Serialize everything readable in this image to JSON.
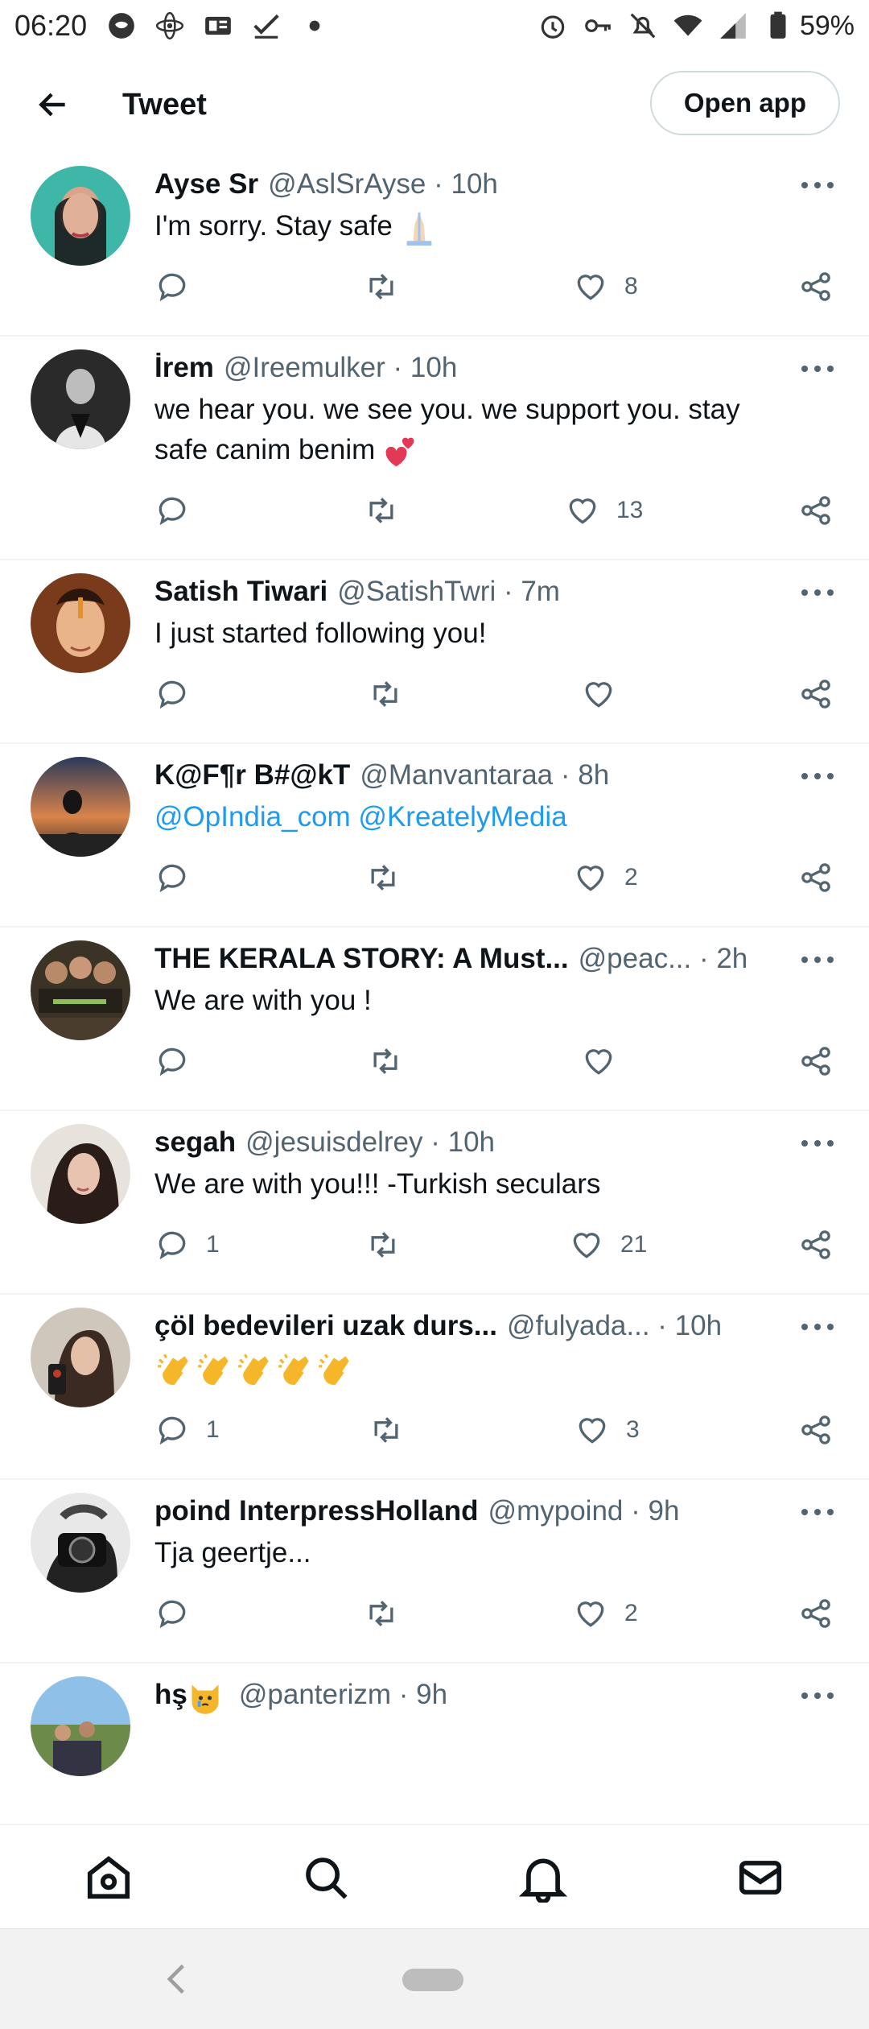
{
  "status_bar": {
    "time": "06:20",
    "battery": "59%"
  },
  "header": {
    "title": "Tweet",
    "open_app_label": "Open app"
  },
  "tweets": [
    {
      "name": "Ayse Sr",
      "handle": "@AslSrAyse · 10h",
      "text": "I'm sorry. Stay safe",
      "text_emoji": "folded-hands",
      "replies": "",
      "likes": "8"
    },
    {
      "name": "İrem",
      "handle": "@Ireemulker · 10h",
      "text": "we hear you. we see you. we support you. stay safe canim benim",
      "text_emoji": "two-hearts",
      "replies": "",
      "likes": "13"
    },
    {
      "name": "Satish Tiwari",
      "handle": "@SatishTwri · 7m",
      "text": "I just started following you!",
      "replies": "",
      "likes": ""
    },
    {
      "name": "K@F¶r B#@kT",
      "handle": "@Manvantaraa · 8h",
      "text": "@OpIndia_com @KreatelyMedia",
      "replies": "",
      "likes": "2"
    },
    {
      "name": "THE KERALA STORY: A Must...",
      "handle": "@peac... · 2h",
      "text": "We are with you !",
      "replies": "",
      "likes": ""
    },
    {
      "name": "segah",
      "handle": "@jesuisdelrey · 10h",
      "text": "We are with you!!! -Turkish seculars",
      "replies": "1",
      "likes": "21"
    },
    {
      "name": "çöl bedevileri uzak durs...",
      "handle": "@fulyada... · 10h",
      "text": "",
      "text_emoji": "clapping-hands-x5",
      "replies": "1",
      "likes": "3"
    },
    {
      "name": "poind InterpressHolland",
      "handle": "@mypoind · 9h",
      "text": "Tja geertje...",
      "replies": "",
      "likes": "2"
    },
    {
      "name": "hş",
      "name_emoji": "crying-cat",
      "handle": "@panterizm · 9h",
      "text": "",
      "replies": "",
      "likes": ""
    }
  ],
  "colors": {
    "link": "#1d9bf0",
    "secondary_text": "#536471",
    "divider": "#eff3f4"
  },
  "icons": {
    "nav": [
      "home-icon",
      "search-icon",
      "notifications-icon",
      "messages-icon"
    ],
    "tweet_actions": [
      "reply-icon",
      "retweet-icon",
      "like-icon",
      "share-icon"
    ]
  }
}
